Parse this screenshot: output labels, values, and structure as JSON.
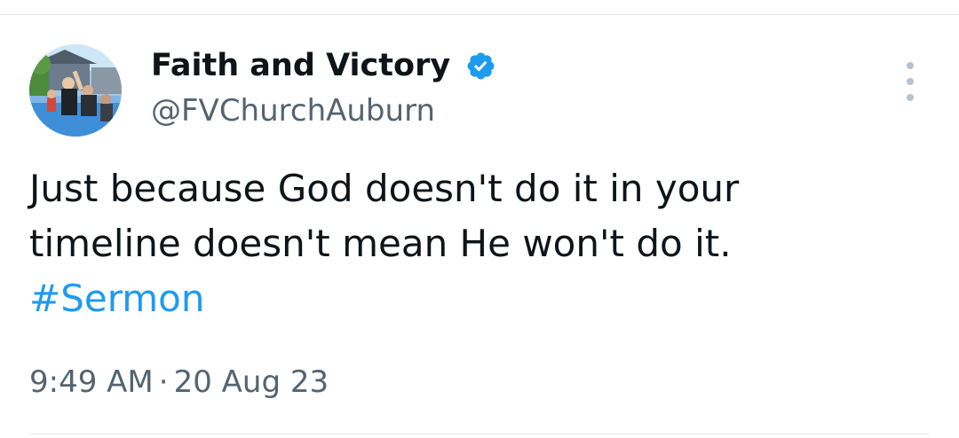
{
  "tweet": {
    "author": {
      "display_name": "Faith and Victory",
      "handle": "@FVChurchAuburn",
      "verified_icon": "verified-badge-icon",
      "avatar_icon": "profile-photo"
    },
    "text_lines": [
      "Just because God doesn't do it in your",
      "timeline doesn't mean He won't do it."
    ],
    "hashtag": "#Sermon",
    "time": "9:49 AM",
    "separator": "·",
    "date": "20 Aug 23",
    "more_icon": "more-vertical-icon"
  },
  "colors": {
    "text": "#0f1419",
    "secondary_text": "#536471",
    "link": "#1d9bf0",
    "verified": "#1d9bf0",
    "divider": "#e4e7ea"
  }
}
